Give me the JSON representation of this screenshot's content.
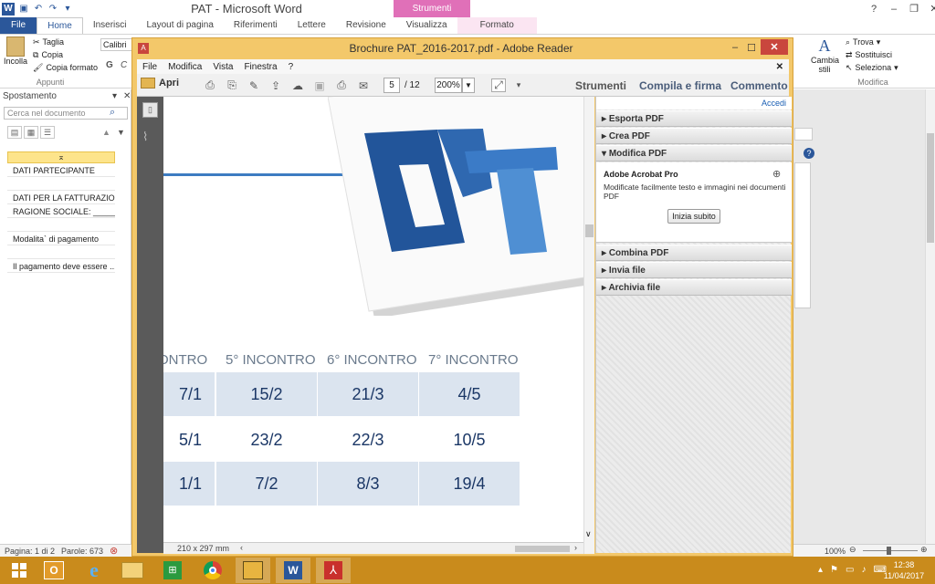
{
  "word": {
    "title": "PAT - Microsoft Word",
    "context_tab_group": "Strumenti immagine",
    "tabs": [
      "File",
      "Home",
      "Inserisci",
      "Layout di pagina",
      "Riferimenti",
      "Lettere",
      "Revisione",
      "Visualizza",
      "Formato"
    ],
    "clipboard": {
      "paste": "Incolla",
      "cut": "Taglia",
      "copy": "Copia",
      "format_painter": "Copia formato",
      "group": "Appunti"
    },
    "font_name": "Calibri (C",
    "editing": {
      "find": "Trova",
      "replace": "Sostituisci",
      "select": "Seleziona",
      "styles": "Cambia stili",
      "group": "Modifica"
    },
    "nav_pane": {
      "title": "Spostamento",
      "search_placeholder": "Cerca nel documento",
      "items": [
        "DATI PARTECIPANTE",
        "DATI PER LA FATTURAZION...",
        "RAGIONE SOCIALE: ______...",
        "Modalita` di pagamento",
        "Il pagamento deve essere ..."
      ]
    },
    "status": {
      "page": "Pagina: 1 di 2",
      "words": "Parole: 673",
      "zoom": "100%"
    }
  },
  "reader": {
    "title": "Brochure PAT_2016-2017.pdf - Adobe Reader",
    "menu": [
      "File",
      "Modifica",
      "Vista",
      "Finestra",
      "?"
    ],
    "open_label": "Apri",
    "page_current": "5",
    "page_total": "/ 12",
    "zoom": "200%",
    "links": [
      "Strumenti",
      "Compila e firma",
      "Commento"
    ],
    "page_size": "210 x 297 mm",
    "pane": {
      "login": "Accedi",
      "sections": [
        "Esporta PDF",
        "Crea PDF",
        "Modifica PDF"
      ],
      "product": "Adobe Acrobat Pro",
      "description": "Modificate facilmente testo e immagini nei documenti PDF",
      "start_button": "Inizia subito",
      "sections_after": [
        "Combina PDF",
        "Invia file",
        "Archivia file"
      ]
    },
    "pdf": {
      "headers": [
        "ONTRO",
        "5° INCONTRO",
        "6° INCONTRO",
        "7° INCONTRO"
      ],
      "rows": [
        [
          "7/1",
          "15/2",
          "21/3",
          "4/5"
        ],
        [
          "5/1",
          "23/2",
          "22/3",
          "10/5"
        ],
        [
          "1/1",
          "7/2",
          "8/3",
          "19/4"
        ]
      ]
    }
  },
  "taskbar": {
    "time": "12:38",
    "date": "11/04/2017"
  }
}
